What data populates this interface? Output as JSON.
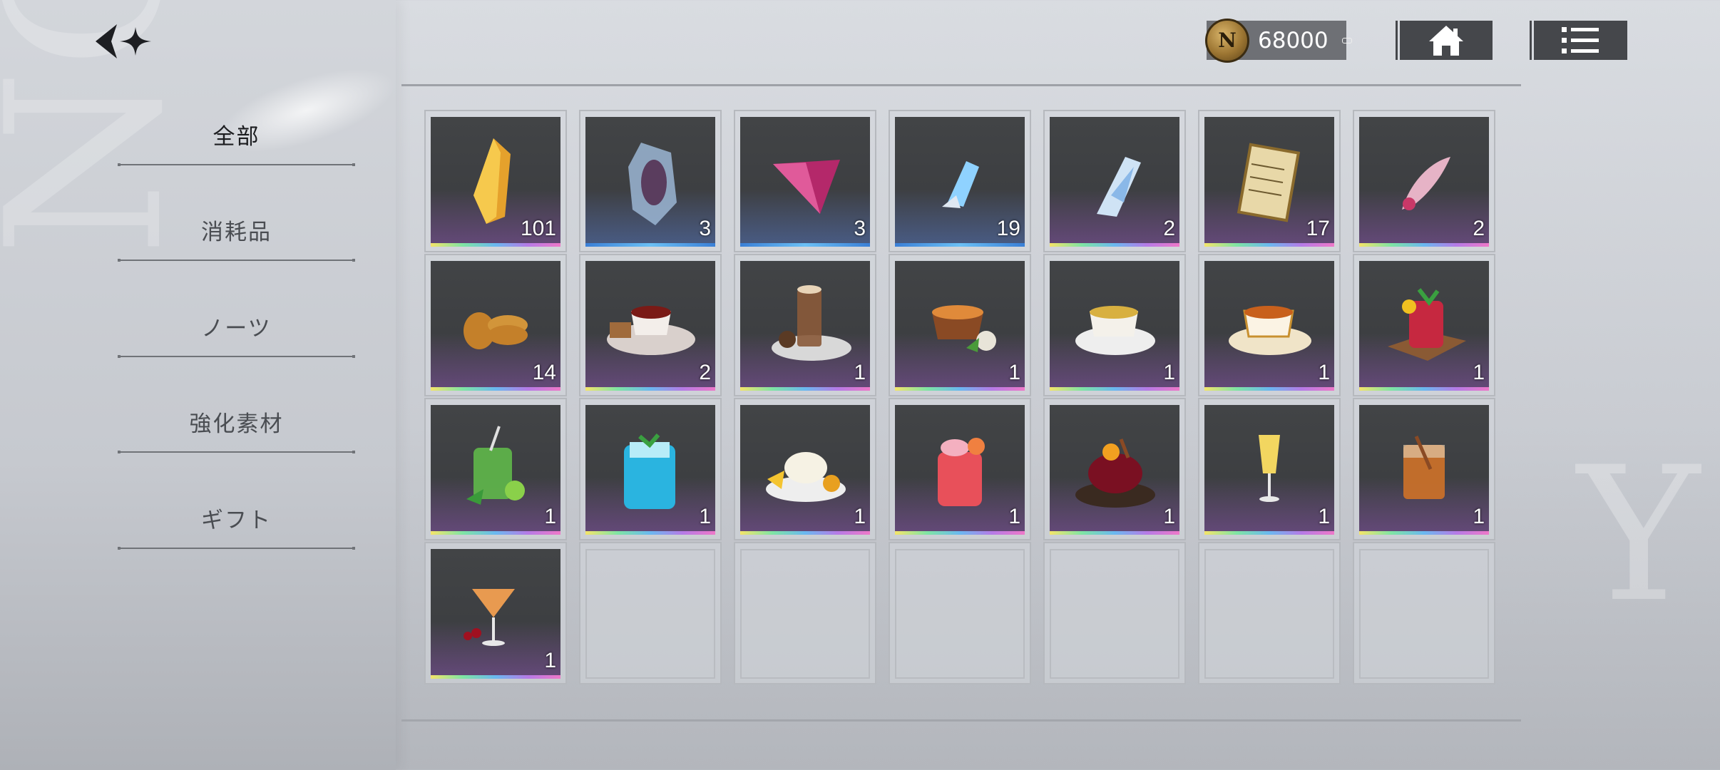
{
  "sidebar": {
    "items": [
      {
        "label": "全部",
        "active": true
      },
      {
        "label": "消耗品",
        "active": false
      },
      {
        "label": "ノーツ",
        "active": false
      },
      {
        "label": "強化素材",
        "active": false
      },
      {
        "label": "ギフト",
        "active": false
      }
    ]
  },
  "header": {
    "currency_amount": "68000",
    "currency_icon": "n-coin-icon",
    "home_icon": "home-icon",
    "menu_icon": "list-menu-icon"
  },
  "inventory": {
    "items": [
      {
        "icon": "amber-crystal-icon",
        "count": "101"
      },
      {
        "icon": "portrait-crystal-icon",
        "count": "3"
      },
      {
        "icon": "pink-gem-icon",
        "count": "3"
      },
      {
        "icon": "blue-crystal-shard-icon",
        "count": "19"
      },
      {
        "icon": "silver-crystal-shard-icon",
        "count": "2"
      },
      {
        "icon": "sheet-music-icon",
        "count": "17"
      },
      {
        "icon": "pink-brooch-icon",
        "count": "2"
      },
      {
        "icon": "cookies-icon",
        "count": "14"
      },
      {
        "icon": "black-tea-cake-icon",
        "count": "2"
      },
      {
        "icon": "cocoa-drink-icon",
        "count": "1"
      },
      {
        "icon": "orange-tea-bowl-icon",
        "count": "1"
      },
      {
        "icon": "lemon-tea-cup-icon",
        "count": "1"
      },
      {
        "icon": "black-tea-cup-icon",
        "count": "1"
      },
      {
        "icon": "berry-soda-icon",
        "count": "1"
      },
      {
        "icon": "mojito-icon",
        "count": "1"
      },
      {
        "icon": "blue-soda-icon",
        "count": "1"
      },
      {
        "icon": "lemon-cream-dessert-icon",
        "count": "1"
      },
      {
        "icon": "grapefruit-soda-icon",
        "count": "1"
      },
      {
        "icon": "hot-fruit-tea-icon",
        "count": "1"
      },
      {
        "icon": "champagne-icon",
        "count": "1"
      },
      {
        "icon": "whiskey-glass-icon",
        "count": "1"
      },
      {
        "icon": "cherry-cocktail-icon",
        "count": "1"
      }
    ],
    "empty_slots": 6
  },
  "colors": {
    "rainbow_bar": [
      "#f4e46a",
      "#7ee4a4",
      "#6ab8f0",
      "#b67ae6",
      "#ee78c8"
    ],
    "blue_bar": "#3a7fd6",
    "button_bg": "#45474b",
    "currency_bg": "#6e7075"
  }
}
